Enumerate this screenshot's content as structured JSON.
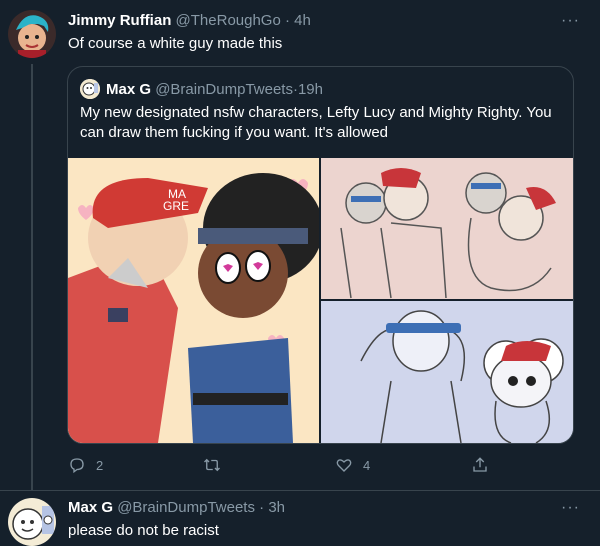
{
  "tweet1": {
    "name": "Jimmy Ruffian",
    "handle": "@TheRoughGo",
    "time": "4h",
    "text": "Of course a white guy made this",
    "quote": {
      "name": "Max G",
      "handle": "@BrainDumpTweets",
      "time": "19h",
      "text": "My new designated nsfw characters, Lefty Lucy and Mighty Righty. You can draw them fucking if you want. It's allowed",
      "images": [
        "artwork-main",
        "artwork-top-right",
        "artwork-bottom-right"
      ]
    },
    "actions": {
      "reply_count": "2",
      "retweet_count": "",
      "like_count": "4"
    },
    "more": "···"
  },
  "tweet2": {
    "name": "Max G",
    "handle": "@BrainDumpTweets",
    "time": "3h",
    "text": "please do not be racist",
    "more": "···"
  },
  "separator": " · ",
  "icons": [
    "reply-icon",
    "retweet-icon",
    "like-icon",
    "share-icon",
    "more-icon"
  ],
  "colors": {
    "background": "#15202b",
    "secondary_text": "#8899a6",
    "border": "#38444d"
  }
}
